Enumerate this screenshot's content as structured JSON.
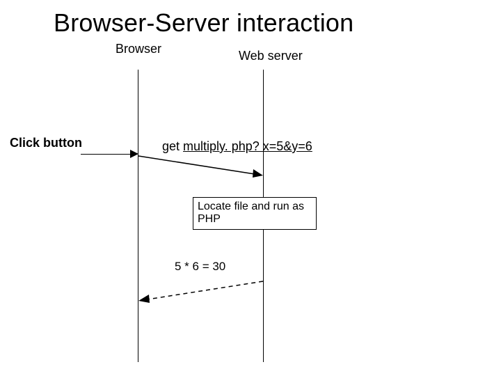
{
  "title": "Browser-Server interaction",
  "actors": {
    "browser": "Browser",
    "server": "Web server"
  },
  "events": {
    "click_label": "Click button",
    "request_prefix": "get ",
    "request_link": "multiply. php? x=5&y=6",
    "process_box": "Locate file and run as PHP",
    "result": "5 * 6 = 30"
  }
}
